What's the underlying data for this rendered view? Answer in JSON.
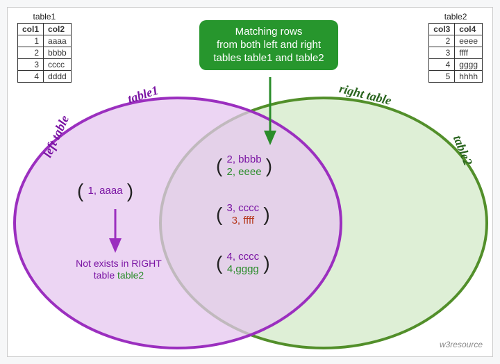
{
  "left_table": {
    "caption": "table1",
    "headers": [
      "col1",
      "col2"
    ],
    "rows": [
      [
        "1",
        "aaaa"
      ],
      [
        "2",
        "bbbb"
      ],
      [
        "3",
        "cccc"
      ],
      [
        "4",
        "dddd"
      ]
    ]
  },
  "right_table": {
    "caption": "table2",
    "headers": [
      "col3",
      "col4"
    ],
    "rows": [
      [
        "2",
        "eeee"
      ],
      [
        "3",
        "ffff"
      ],
      [
        "4",
        "gggg"
      ],
      [
        "5",
        "hhhh"
      ]
    ]
  },
  "callout": {
    "line1": "Matching rows",
    "line2": "from both left and right",
    "line3": "tables table1 and table2"
  },
  "labels": {
    "left_outer": "left table",
    "left_inner": "table1",
    "right_outer": "right table",
    "right_inner": "table2"
  },
  "left_only": {
    "row": "1, aaaa"
  },
  "intersections": [
    {
      "left": "2, bbbb",
      "right": "2,  eeee"
    },
    {
      "left": "3, cccc",
      "right": "3, ffff"
    },
    {
      "left": "4, cccc",
      "right": "4,gggg"
    }
  ],
  "left_note": {
    "line1": "Not exists in RIGHT",
    "line2a": "table ",
    "line2b": "table2"
  },
  "watermark": "w3resource",
  "colors": {
    "purple_stroke": "#9b2fbf",
    "purple_fill": "#e6c7ef",
    "green_stroke": "#528f2a",
    "green_fill": "#d8eccf",
    "callout_bg": "#27962d"
  }
}
